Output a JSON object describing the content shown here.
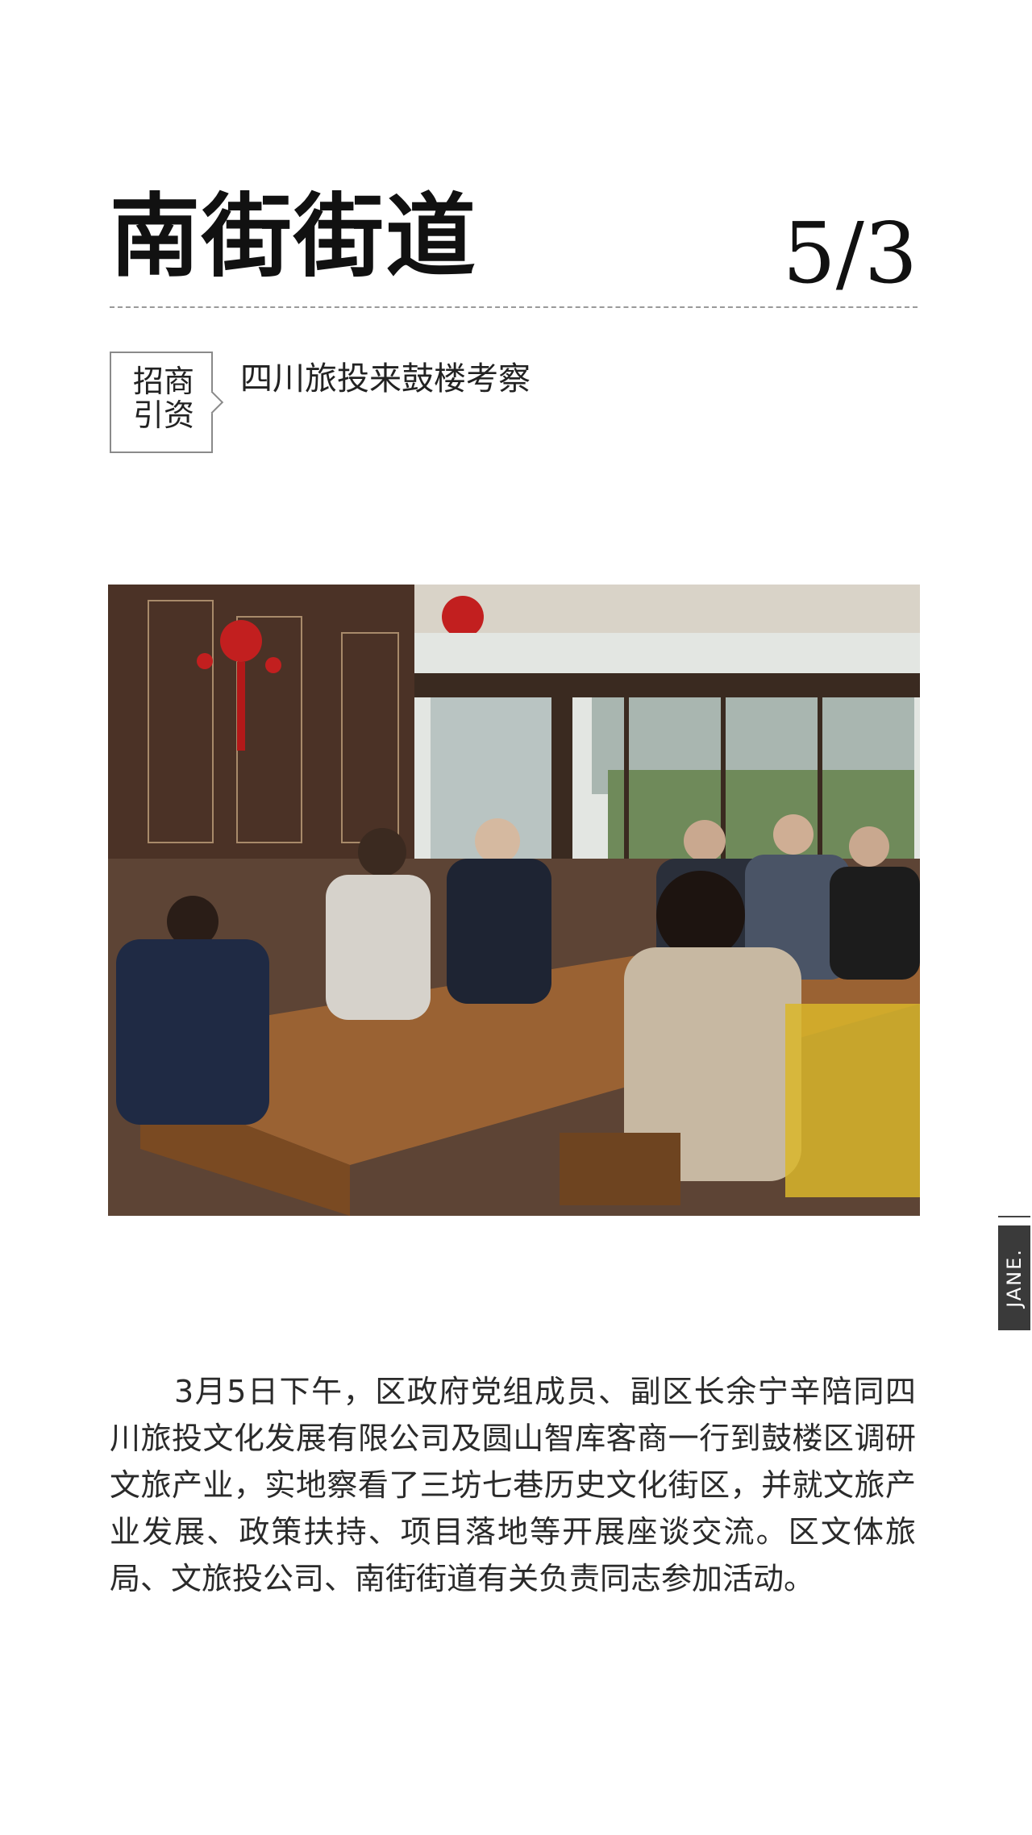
{
  "header": {
    "title": "南街街道",
    "date": "5/3"
  },
  "tag": {
    "label": "招商引资"
  },
  "article": {
    "headline": "四川旅投来鼓楼考察",
    "body": "3月5日下午，区政府党组成员、副区长余宁辛陪同四川旅投文化发展有限公司及圆山智库客商一行到鼓楼区调研文旅产业，实地察看了三坊七巷历史文化街区，并就文旅产业发展、政策扶持、项目落地等开展座谈交流。区文体旅局、文旅投公司、南街街道有关负责同志参加活动。"
  },
  "side_tab": {
    "label": "JANE."
  },
  "colors": {
    "text": "#1a1a1a",
    "divider": "#9a9a9a",
    "tab_bg": "#3a3a3a"
  }
}
